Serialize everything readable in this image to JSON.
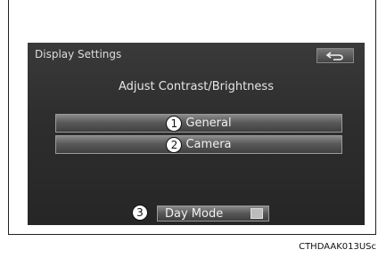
{
  "screen": {
    "title": "Display Settings",
    "back_icon": "back-arrow-icon",
    "heading": "Adjust Contrast/Brightness"
  },
  "options": [
    {
      "callout": "1",
      "label": "General"
    },
    {
      "callout": "2",
      "label": "Camera"
    }
  ],
  "day_mode": {
    "callout": "3",
    "label": "Day Mode",
    "state": "off"
  },
  "caption": "CTHDAAK013USc",
  "colors": {
    "screen_bg": "#2e2e2e",
    "button_top": "#8a8a8a",
    "button_bottom": "#404040",
    "text": "#f0f0f0"
  }
}
